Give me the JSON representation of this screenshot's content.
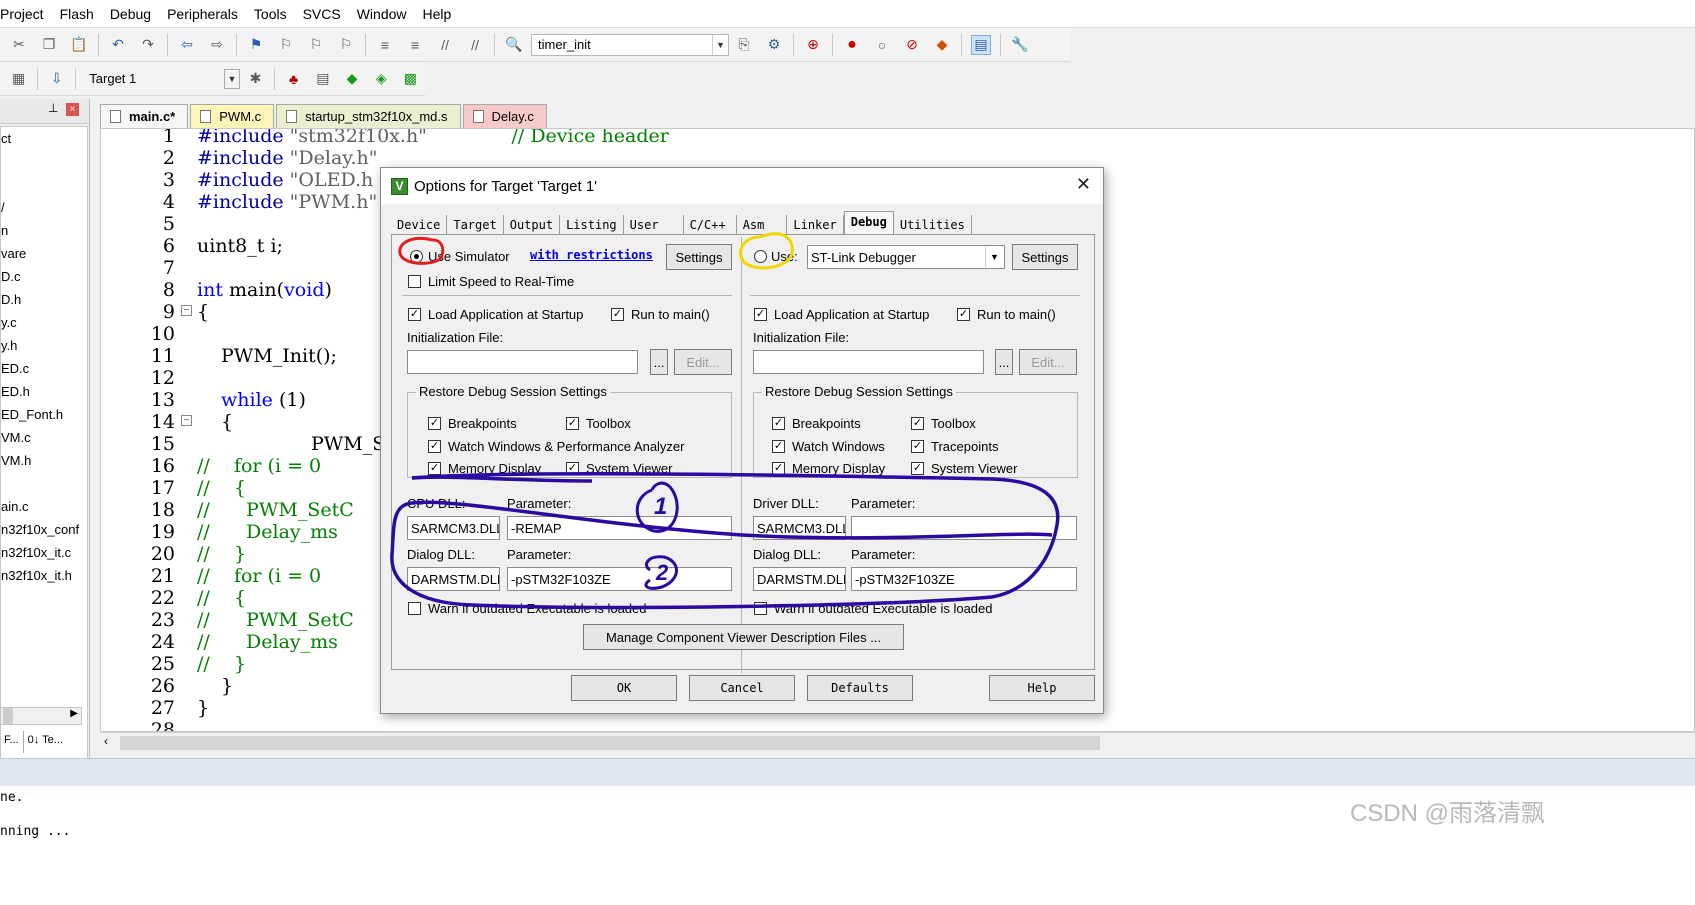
{
  "menu": [
    "Project",
    "Flash",
    "Debug",
    "Peripherals",
    "Tools",
    "SVCS",
    "Window",
    "Help"
  ],
  "toolbar1": {
    "combo_value": "timer_init"
  },
  "toolbar2": {
    "target_combo": "Target 1"
  },
  "project_tree": [
    "ct",
    "",
    "",
    "/",
    "n",
    "vare",
    "D.c",
    "D.h",
    "y.c",
    "y.h",
    "ED.c",
    "ED.h",
    "ED_Font.h",
    "VM.c",
    "VM.h",
    "",
    "ain.c",
    "n32f10x_conf",
    "n32f10x_it.c",
    "n32f10x_it.h"
  ],
  "panel_tabs": [
    "F...",
    "0↓ Te..."
  ],
  "file_tabs": [
    {
      "label": "main.c*",
      "color": "#f6f6f6"
    },
    {
      "label": "PWM.c",
      "color": "#fdf5b8"
    },
    {
      "label": "startup_stm32f10x_md.s",
      "color": "#e9f0cf"
    },
    {
      "label": "Delay.c",
      "color": "#f7c9c9"
    }
  ],
  "code": {
    "line_numbers": [
      "1",
      "2",
      "3",
      "4",
      "5",
      "6",
      "7",
      "8",
      "9",
      "10",
      "11",
      "12",
      "13",
      "14",
      "15",
      "16",
      "17",
      "18",
      "19",
      "20",
      "21",
      "22",
      "23",
      "24",
      "25",
      "26",
      "27",
      "28"
    ],
    "l1a": "#include",
    "l1b": "\"stm32f10x.h\"",
    "l1c": "// Device header",
    "l2a": "#include",
    "l2b": "\"Delay.h\"",
    "l3a": "#include",
    "l3b": "\"OLED.h",
    "l4a": "#include",
    "l4b": "\"PWM.h\"",
    "l6": "uint8_t i;",
    "l8a": "int",
    "l8b": " main(",
    "l8c": "void",
    "l8d": ")",
    "l9": "{",
    "l11": "PWM_Init();",
    "l13a": "while",
    "l13b": " (1)",
    "l14": "{",
    "l15": "PWM_Se",
    "l16": "//    for (i = 0",
    "l17": "//    {",
    "l18": "//      PWM_SetC",
    "l19": "//      Delay_ms",
    "l20": "//    }",
    "l21": "//    for (i = 0",
    "l22": "//    {",
    "l23": "//      PWM_SetC",
    "l24": "//      Delay_ms",
    "l25": "//    }",
    "l26": "}",
    "l27": "}"
  },
  "output": {
    "line1": "ne.",
    "line2": "nning ..."
  },
  "watermark": "CSDN @雨落清飘",
  "dialog": {
    "title": "Options for Target 'Target 1'",
    "tabs": [
      "Device",
      "Target",
      "Output",
      "Listing",
      "User",
      "C/C++",
      "Asm",
      "Linker",
      "Debug",
      "Utilities"
    ],
    "active_tab": "Debug",
    "left": {
      "use_simulator": "Use Simulator",
      "with_restrictions": "with restrictions",
      "settings": "Settings",
      "limit_speed": "Limit Speed to Real-Time",
      "load_app": "Load Application at Startup",
      "run_to_main": "Run to main()",
      "init_file": "Initialization File:",
      "browse": "...",
      "edit": "Edit...",
      "restore_group": "Restore Debug Session Settings",
      "breakpoints": "Breakpoints",
      "toolbox": "Toolbox",
      "watch_windows": "Watch Windows & Performance Analyzer",
      "memory_display": "Memory Display",
      "system_viewer": "System Viewer",
      "cpu_dll_label": "CPU DLL:",
      "param_label": "Parameter:",
      "cpu_dll": "SARMCM3.DLL",
      "cpu_param": "-REMAP",
      "dialog_dll_label": "Dialog DLL:",
      "dialog_dll": "DARMSTM.DLL",
      "dialog_param": "-pSTM32F103ZE",
      "warn": "Warn if outdated Executable is loaded"
    },
    "right": {
      "use": "Use:",
      "debugger": "ST-Link Debugger",
      "settings": "Settings",
      "load_app": "Load Application at Startup",
      "run_to_main": "Run to main()",
      "init_file": "Initialization File:",
      "browse": "...",
      "edit": "Edit...",
      "restore_group": "Restore Debug Session Settings",
      "breakpoints": "Breakpoints",
      "toolbox": "Toolbox",
      "watch_windows": "Watch Windows",
      "tracepoints": "Tracepoints",
      "memory_display": "Memory Display",
      "system_viewer": "System Viewer",
      "driver_dll_label": "Driver DLL:",
      "param_label": "Parameter:",
      "driver_dll": "SARMCM3.DLL",
      "driver_param": "",
      "dialog_dll_label": "Dialog DLL:",
      "dialog_dll": "DARMSTM.DLL",
      "dialog_param": "-pSTM32F103ZE",
      "warn": "Warn if outdated Executable is loaded"
    },
    "manage_btn": "Manage Component Viewer Description Files ...",
    "ok": "OK",
    "cancel": "Cancel",
    "defaults": "Defaults",
    "help": "Help",
    "annotation_1": "1",
    "annotation_2": "2"
  }
}
